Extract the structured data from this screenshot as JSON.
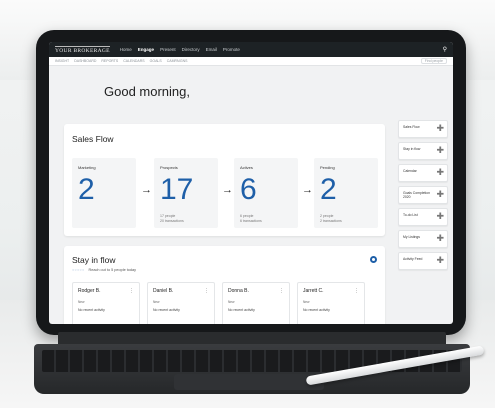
{
  "app": {
    "logo": "YOUR BROKERAGE",
    "nav": [
      "Home",
      "Engage",
      "Present",
      "Directory",
      "Email",
      "Promote"
    ],
    "active_nav": "Engage",
    "subnav": [
      "Insight",
      "Dashboard",
      "Reports",
      "Calendars",
      "Goals",
      "Campaigns"
    ],
    "search_placeholder": "Find people"
  },
  "greeting": "Good morning,",
  "sales_flow": {
    "title": "Sales Flow",
    "stages": [
      {
        "label": "Marketing",
        "count": "2",
        "people": "",
        "transactions": ""
      },
      {
        "label": "Prospects",
        "count": "17",
        "people": "17 people",
        "transactions": "20 transactions"
      },
      {
        "label": "Actives",
        "count": "6",
        "people": "6 people",
        "transactions": "6 transactions"
      },
      {
        "label": "Pending",
        "count": "2",
        "people": "2 people",
        "transactions": "2 transactions"
      }
    ]
  },
  "stay_in_flow": {
    "title": "Stay in flow",
    "progress_dots": "○○○○○",
    "subtitle": "Reach out to 5 people today",
    "contacts": [
      {
        "name": "Rodger B.",
        "status": "New",
        "activity": "No recent activity"
      },
      {
        "name": "Daniel B.",
        "status": "New",
        "activity": "No recent activity"
      },
      {
        "name": "Donna B.",
        "status": "New",
        "activity": "No recent activity"
      },
      {
        "name": "Jarrett C.",
        "status": "New",
        "activity": "No recent activity"
      }
    ]
  },
  "sidebar": [
    "Sales Flow",
    "Stay in flow",
    "Calendar",
    "Goals Completion 2020",
    "To-do List",
    "My Listings",
    "Activity Feed"
  ],
  "icons": {
    "search": "search-icon",
    "plus": "plus-icon",
    "gear": "gear-icon",
    "menu": "more-vertical-icon"
  },
  "colors": {
    "accent": "#1e5fa8",
    "topbar": "#1d2225"
  }
}
